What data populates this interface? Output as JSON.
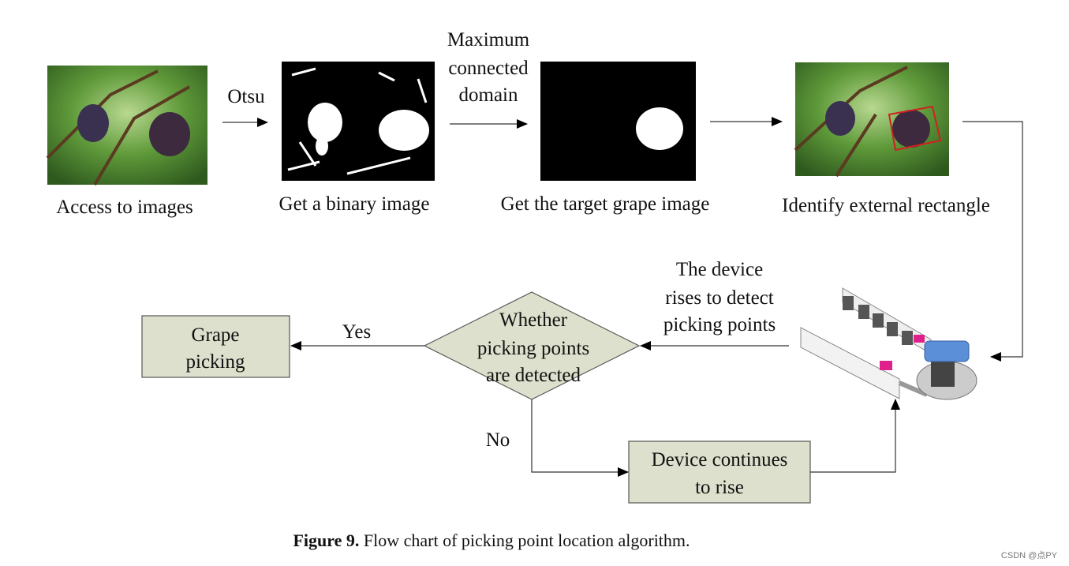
{
  "steps": {
    "access": {
      "label": "Access to images"
    },
    "binary": {
      "label": "Get a binary image",
      "arrow_in": "Otsu"
    },
    "target": {
      "label": "Get the target grape image",
      "arrow_in": [
        "Maximum",
        "connected",
        "domain"
      ]
    },
    "rectangle": {
      "label": "Identify external rectangle"
    }
  },
  "device_note": [
    "The device",
    "rises to detect",
    "picking points"
  ],
  "decision": {
    "lines": [
      "Whether",
      "picking points",
      "are detected"
    ],
    "yes": "Yes",
    "no": "No"
  },
  "grape_picking": [
    "Grape",
    "picking"
  ],
  "continue_box": [
    "Device continues",
    "to rise"
  ],
  "caption": {
    "bold": "Figure 9.",
    "text": " Flow chart of picking point location algorithm."
  },
  "watermark": "CSDN @点PY",
  "colors": {
    "box_fill": "#dde0cc",
    "rect_marker": "#d02020"
  }
}
